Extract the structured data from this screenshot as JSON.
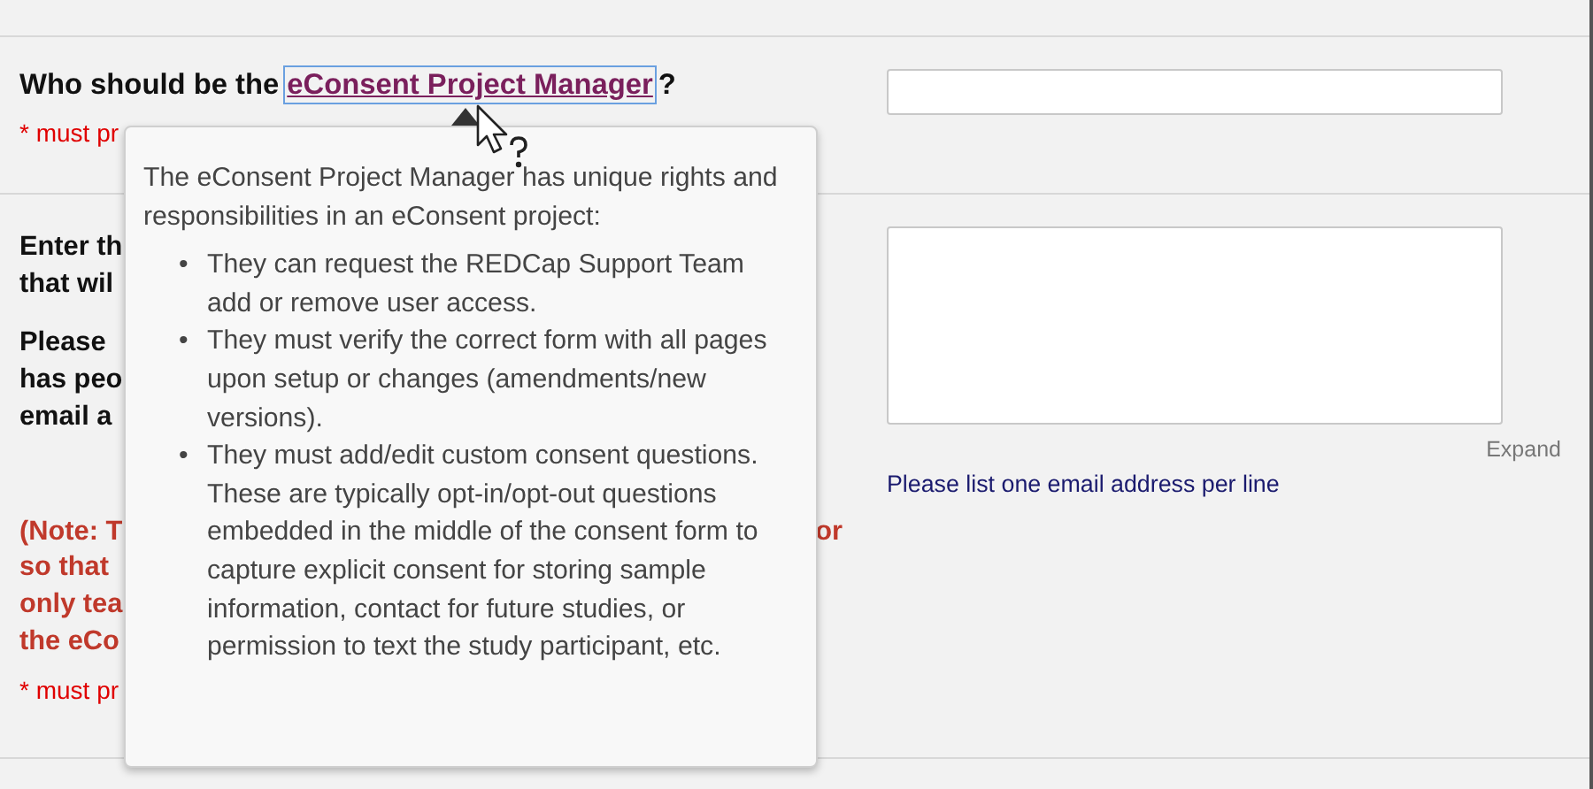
{
  "sections": [
    {
      "kind": "text-input",
      "prompt": "Who should be the ",
      "prompt_link": {
        "text": "eConsent Project Manager",
        "focused": true
      },
      "prompt_end": "?",
      "required_note": "* must pr"
    },
    {
      "kind": "textarea",
      "prompt_groups": [
        [
          "Enter th",
          "that wil"
        ],
        [
          "Please",
          "has peo",
          "email a"
        ]
      ],
      "note_lines": [
        "(Note: T",
        "so that",
        "only tea",
        "the eCo"
      ],
      "note_tail": "or",
      "required_note": "* must pr",
      "expand_link": "Expand",
      "hint": "Please list one email address per line"
    }
  ],
  "tooltip": {
    "bullet": "•",
    "intro": "The eConsent Project Manager has unique rights and responsibilities in an eConsent project:",
    "items": [
      "They can request the REDCap Support Team add or remove user access.",
      "They must verify the correct form with all pages upon setup or changes (amendments/new versions).",
      "They must add/edit custom consent questions. These are typically opt-in/opt-out questions embedded in the middle of the consent form to capture explicit consent for storing sample information, contact for future studies, or permission to text the study participant, etc."
    ]
  }
}
